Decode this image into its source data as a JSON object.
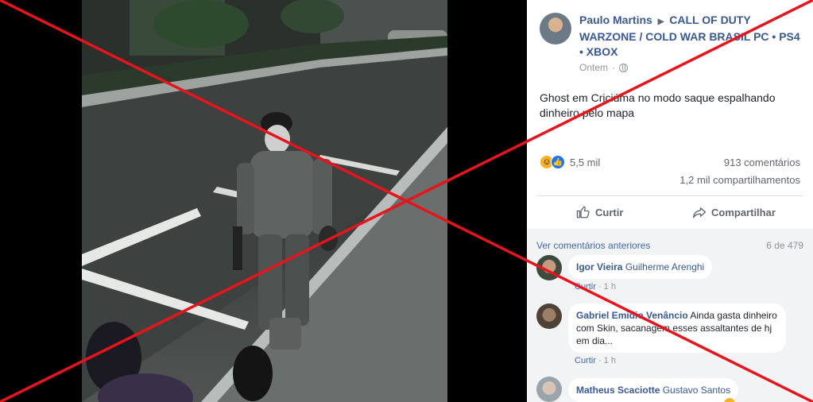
{
  "post": {
    "author": "Paulo Martins",
    "group": "CALL OF DUTY WARZONE / COLD WAR BRASIL PC • PS4 • XBOX",
    "time": "Ontem",
    "text": "Ghost em Criciúma no modo saque espalhando dinheiro pelo mapa",
    "reactions_count": "5,5 mil",
    "comments_count": "913 comentários",
    "shares_count": "1,2 mil compartilhamentos",
    "like_label": "Curtir",
    "share_label": "Compartilhar"
  },
  "comments": {
    "view_previous": "Ver comentários anteriores",
    "pager": "6 de 479",
    "items": [
      {
        "author": "Igor Vieira",
        "tag": "Guilherme Arenghi",
        "text": "",
        "reply": "Curtir",
        "time": "1 h"
      },
      {
        "author": "Gabriel Emidio Venâncio",
        "tag": "",
        "text": "Ainda gasta dinheiro com Skin, sacanagem esses assaltantes de hj em dia...",
        "reply": "Curtir",
        "time": "1 h"
      },
      {
        "author": "Matheus Scaciotte",
        "tag": "Gustavo Santos",
        "text": "",
        "reply": "",
        "time": ""
      }
    ]
  },
  "colors": {
    "link_blue": "#385898",
    "cross_red": "#e8141b"
  },
  "icons": [
    "globe-icon",
    "haha-reaction-icon",
    "like-reaction-icon",
    "thumbs-up-icon",
    "share-arrow-icon"
  ]
}
